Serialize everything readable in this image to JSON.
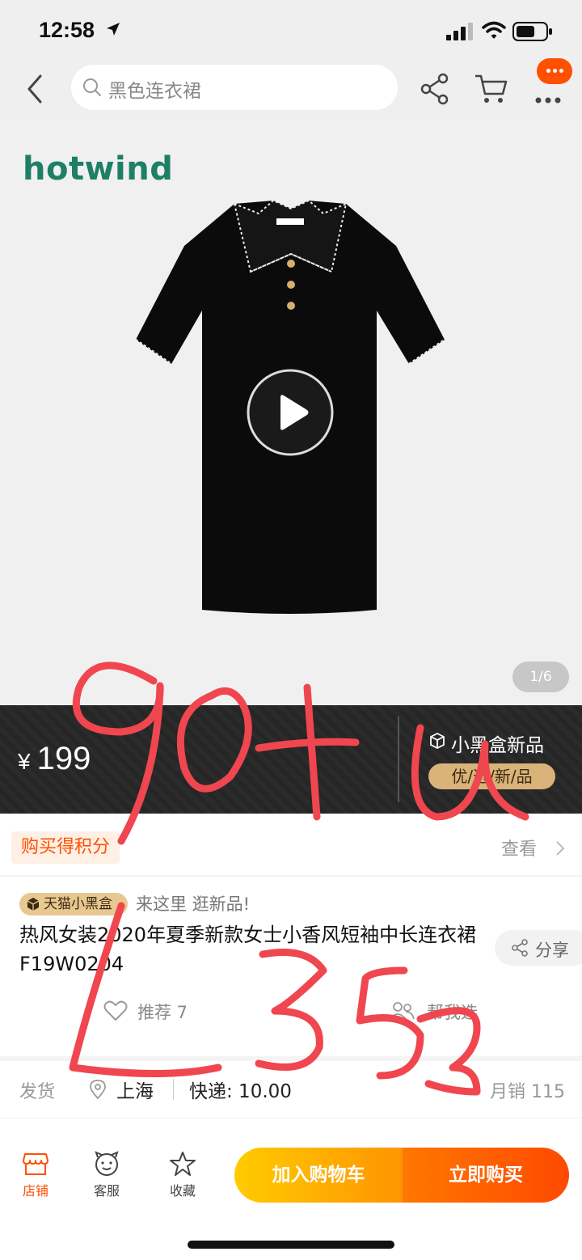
{
  "status_bar": {
    "time": "12:58"
  },
  "nav": {
    "search_placeholder": "黑色连衣裙",
    "icons": [
      "back-arrow-icon",
      "search-icon",
      "share-icon",
      "cart-icon",
      "more-icon"
    ]
  },
  "product_image": {
    "brand": "hotwind",
    "counter": "1/6"
  },
  "price_banner": {
    "currency": "¥",
    "price": "199",
    "blackbox_title": "小黑盒新品",
    "blackbox_tag": "优/选/新/品"
  },
  "points": {
    "tag": "购买得积分",
    "view": "查看"
  },
  "title_section": {
    "tmall_badge": "天猫小黑盒",
    "tmall_slogan": "来这里 逛新品!",
    "title": "热风女装2020年夏季新款女士小香风短袖中长连衣裙F19W0204",
    "share": "分享",
    "recommend": "推荐 7",
    "help_choose": "帮我选"
  },
  "shipping": {
    "label": "发货",
    "city": "上海",
    "fee": "快递: 10.00",
    "monthly_sales": "月销 115"
  },
  "bottom_bar": {
    "store": "店铺",
    "service": "客服",
    "favorite": "收藏",
    "add_to_cart": "加入购物车",
    "buy_now": "立即购买"
  },
  "colors": {
    "accent": "#ff5000",
    "brand_green": "#1f7f64",
    "handwriting_red": "#f0464f"
  }
}
